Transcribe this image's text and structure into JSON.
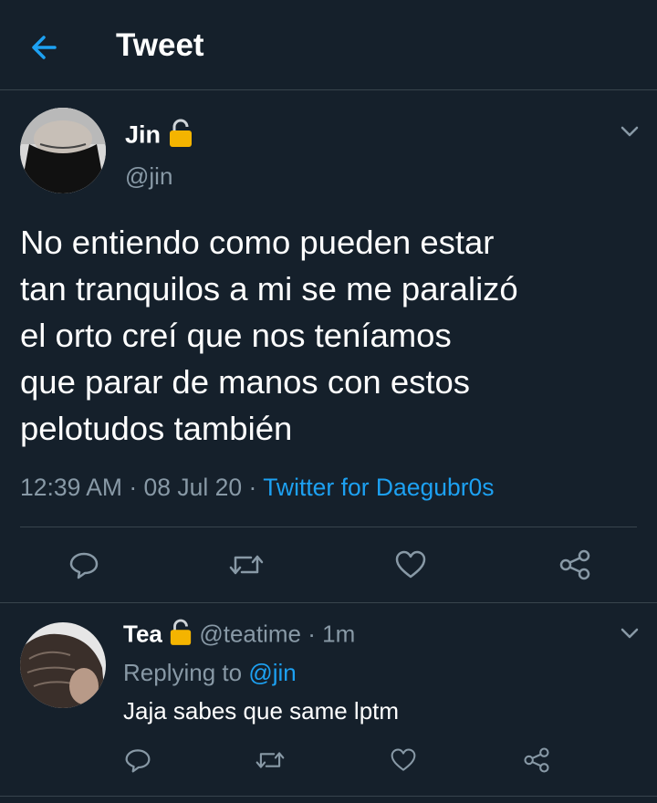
{
  "header": {
    "title": "Tweet"
  },
  "tweet": {
    "author_name": "Jin",
    "author_handle": "@jin",
    "lines": [
      "No entiendo como pueden estar",
      "tan tranquilos a mi se me paralizó",
      "el orto creí que nos teníamos",
      "que parar de manos con estos",
      "pelotudos también"
    ],
    "time": "12:39 AM",
    "date": "08 Jul 20",
    "separator": "·",
    "source": "Twitter for Daegubr0s"
  },
  "reply": {
    "author_name": "Tea",
    "author_handle": "@teatime",
    "separator": "·",
    "age": "1m",
    "replying_prefix": "Replying to",
    "replying_handle": "@jin",
    "text": "Jaja sabes que same lptm"
  },
  "icons": {
    "back": "arrow-left-icon",
    "lock": "lock-icon",
    "more": "chevron-down-icon",
    "reply": "reply-icon",
    "retweet": "retweet-icon",
    "like": "heart-icon",
    "share": "share-icon"
  },
  "colors": {
    "background": "#15202b",
    "accent": "#1da1f2",
    "muted": "#8899a6",
    "divider": "#38444d",
    "lock": "#f4b400"
  }
}
